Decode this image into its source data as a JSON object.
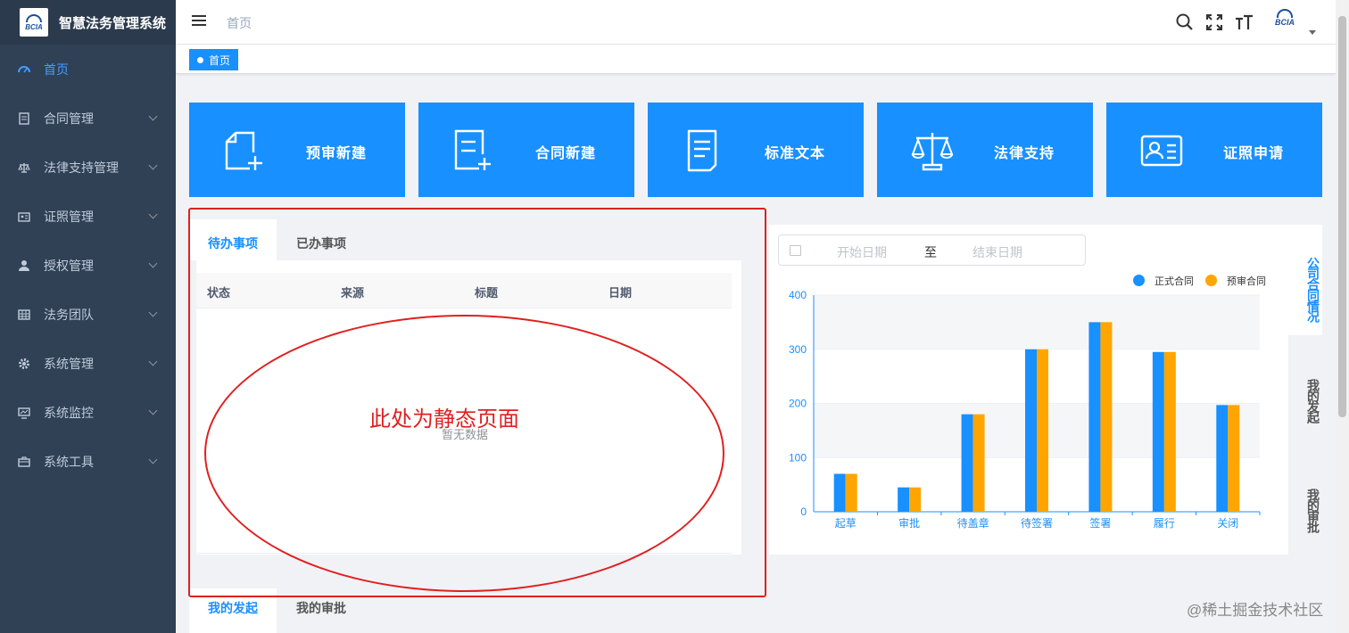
{
  "app": {
    "title": "智慧法务管理系统",
    "logo_text": "BCIA"
  },
  "sidebar": {
    "items": [
      {
        "label": "首页",
        "icon": "dashboard-icon",
        "active": true
      },
      {
        "label": "合同管理",
        "icon": "document-icon"
      },
      {
        "label": "法律支持管理",
        "icon": "scale-icon"
      },
      {
        "label": "证照管理",
        "icon": "id-card-icon"
      },
      {
        "label": "授权管理",
        "icon": "user-icon"
      },
      {
        "label": "法务团队",
        "icon": "table-icon"
      },
      {
        "label": "系统管理",
        "icon": "gear-icon"
      },
      {
        "label": "系统监控",
        "icon": "monitor-icon"
      },
      {
        "label": "系统工具",
        "icon": "toolbox-icon"
      }
    ]
  },
  "header": {
    "breadcrumb": "首页",
    "avatar_text": "BCIA"
  },
  "tags_view": {
    "active_tag": "首页"
  },
  "quick_cards": [
    {
      "label": "预审新建",
      "icon": "new-file-icon"
    },
    {
      "label": "合同新建",
      "icon": "new-contract-icon"
    },
    {
      "label": "标准文本",
      "icon": "standard-text-icon"
    },
    {
      "label": "法律支持",
      "icon": "scale-icon"
    },
    {
      "label": "证照申请",
      "icon": "id-card-icon"
    }
  ],
  "todo": {
    "tabs": [
      "待办事项",
      "已办事项"
    ],
    "columns": [
      "状态",
      "来源",
      "标题",
      "日期"
    ],
    "empty_text": "暂无数据"
  },
  "annotation": {
    "text": "此处为静态页面",
    "color": "#e02020"
  },
  "bottom_tabs": [
    "我的发起",
    "我的审批"
  ],
  "date_range": {
    "start_placeholder": "开始日期",
    "separator": "至",
    "end_placeholder": "结束日期"
  },
  "side_tabs": [
    "公司合同情况",
    "我的发起",
    "我的审批"
  ],
  "chart_data": {
    "type": "bar",
    "categories": [
      "起草",
      "审批",
      "待盖章",
      "待签署",
      "签署",
      "履行",
      "关闭"
    ],
    "series": [
      {
        "name": "正式合同",
        "color": "#1890ff",
        "values": [
          70,
          45,
          180,
          300,
          350,
          295,
          197
        ]
      },
      {
        "name": "预审合同",
        "color": "#ffa500",
        "values": [
          70,
          45,
          180,
          300,
          350,
          295,
          197
        ]
      }
    ],
    "ylim": [
      0,
      400
    ],
    "yticks": [
      0,
      100,
      200,
      300,
      400
    ],
    "legend": "top-right",
    "grid": true
  },
  "watermark": "@稀土掘金技术社区",
  "colors": {
    "primary": "#1890ff",
    "sidebar_bg": "#304156",
    "annotation": "#e02020"
  }
}
